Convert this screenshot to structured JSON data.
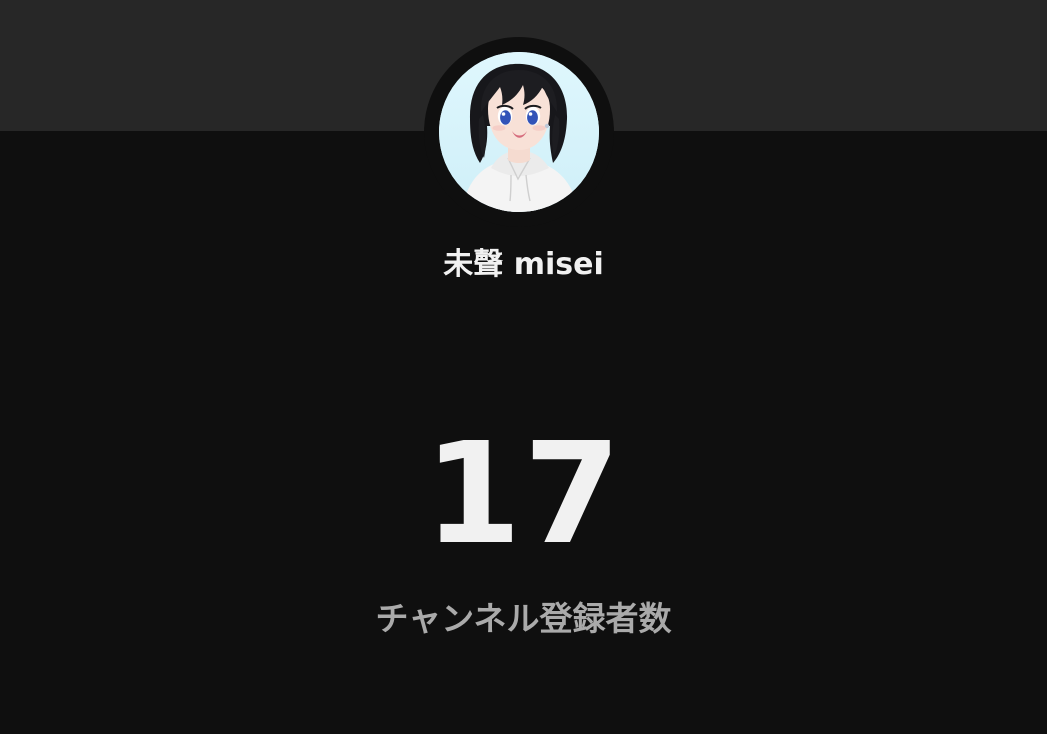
{
  "channel": {
    "name": "未聲 misei",
    "avatar_description": "anime-style channel avatar"
  },
  "stats": {
    "subscriber_count": "17",
    "subscriber_label": "チャンネル登録者数"
  },
  "colors": {
    "page_background": "#0f0f0f",
    "banner_background": "#272727",
    "primary_text": "#f1f1f1",
    "secondary_text": "#aaaaaa",
    "avatar_background": "#d8f3fb"
  }
}
